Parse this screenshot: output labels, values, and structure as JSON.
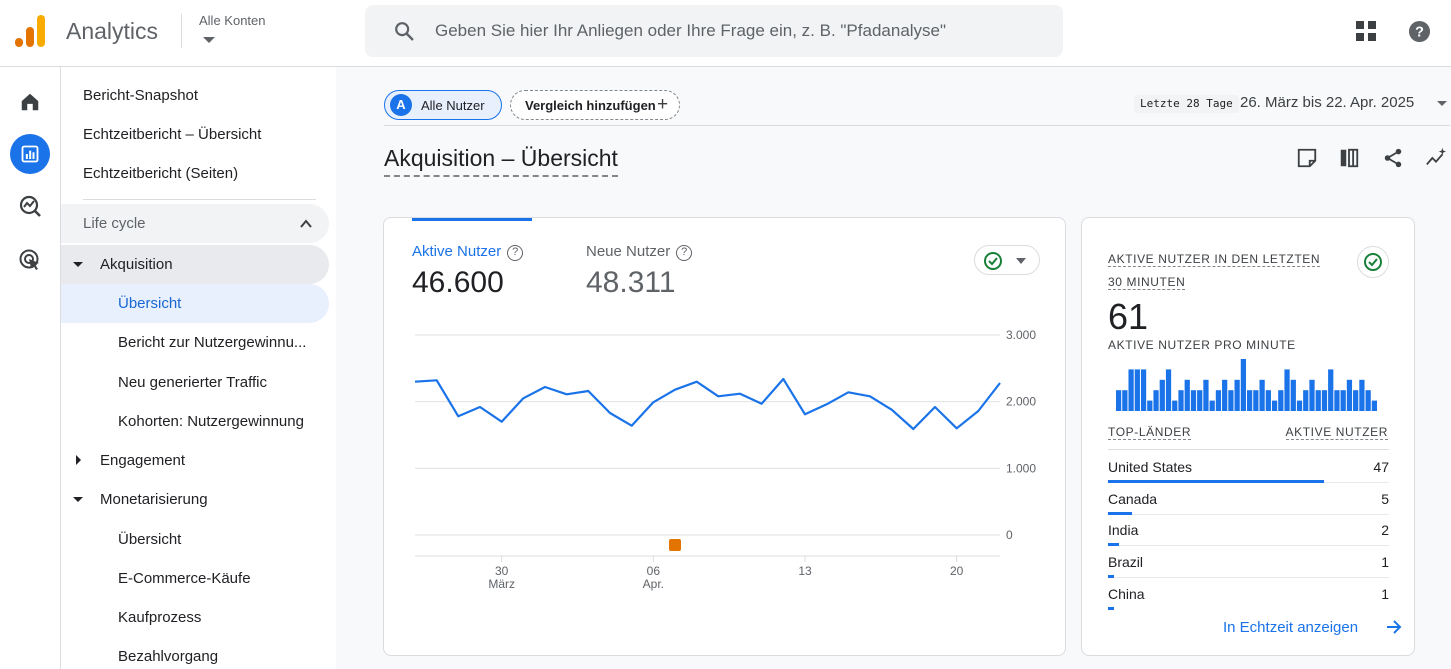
{
  "header": {
    "app_title": "Analytics",
    "account_label": "Alle Konten",
    "search_placeholder": "Geben Sie hier Ihr Anliegen oder Ihre Frage ein, z. B. \"Pfadanalyse\"",
    "logo_colors": [
      "#f9ab00",
      "#e37400"
    ]
  },
  "rail": {
    "items": [
      {
        "icon": "home-icon",
        "active": false
      },
      {
        "icon": "reports-icon",
        "active": true
      },
      {
        "icon": "explore-icon",
        "active": false
      },
      {
        "icon": "advertising-icon",
        "active": false
      }
    ]
  },
  "nav": {
    "top_items": [
      "Bericht-Snapshot",
      "Echtzeitbericht – Übersicht",
      "Echtzeitbericht (Seiten)"
    ],
    "lifecycle_label": "Life cycle",
    "sections": [
      {
        "label": "Akquisition",
        "open": true,
        "children": [
          {
            "label": "Übersicht",
            "selected": true
          },
          {
            "label": "Bericht zur Nutzergewinnu..."
          },
          {
            "label": "Neu generierter Traffic"
          },
          {
            "label": "Kohorten: Nutzergewinnung"
          }
        ]
      },
      {
        "label": "Engagement",
        "open": false,
        "children": []
      },
      {
        "label": "Monetarisierung",
        "open": true,
        "children": [
          {
            "label": "Übersicht"
          },
          {
            "label": "E-Commerce-Käufe"
          },
          {
            "label": "Kaufprozess"
          },
          {
            "label": "Bezahlvorgang"
          }
        ]
      }
    ]
  },
  "filters": {
    "segment_badge": "A",
    "segment_label": "Alle Nutzer",
    "compare_label": "Vergleich hinzufügen",
    "date_badge": "Letzte 28 Tage",
    "date_range": "26. März bis 22. Apr. 2025"
  },
  "page": {
    "title": "Akquisition – Übersicht",
    "tool_icons": [
      "customize-report-icon",
      "compare-columns-icon",
      "share-icon",
      "insights-icon"
    ]
  },
  "metrics": {
    "active_label": "Aktive Nutzer",
    "active_value": "46.600",
    "new_label": "Neue Nutzer",
    "new_value": "48.311",
    "help_glyph": "?"
  },
  "chart_data": {
    "type": "line",
    "series": [
      {
        "values": [
          2300,
          2320,
          1780,
          1920,
          1700,
          2050,
          2220,
          2110,
          2160,
          1830,
          1640,
          1990,
          2180,
          2300,
          2080,
          2120,
          1970,
          2340,
          1810,
          1960,
          2140,
          2080,
          1880,
          1590,
          1920,
          1600,
          1860,
          2280
        ],
        "color": "#1a73e8"
      }
    ],
    "x_tick_labels": [
      {
        "day": "30",
        "month": "März",
        "index": 4
      },
      {
        "day": "06",
        "month": "Apr.",
        "index": 11
      },
      {
        "day": "13",
        "month": "",
        "index": 18
      },
      {
        "day": "20",
        "month": "",
        "index": 25
      }
    ],
    "y_tick_labels": [
      "3.000",
      "2.000",
      "1.000",
      "0"
    ],
    "ylim": [
      0,
      3000
    ],
    "annotation_marker_index": 12,
    "annotation_color": "#e37400",
    "grid": true
  },
  "realtime": {
    "heading_line1": "AKTIVE NUTZER IN DEN LETZTEN",
    "heading_line2": "30 MINUTEN",
    "count": "61",
    "per_minute_label": "AKTIVE NUTZER PRO MINUTE",
    "per_minute_bars": [
      2,
      2,
      4,
      4,
      4,
      1,
      2,
      3,
      4,
      1,
      2,
      3,
      2,
      2,
      3,
      1,
      2,
      3,
      2,
      3,
      5,
      2,
      2,
      3,
      2,
      1,
      2,
      4,
      3,
      1,
      2,
      3,
      2,
      2,
      4,
      2,
      2,
      3,
      2,
      3,
      2,
      1
    ],
    "col_country": "TOP-LÄNDER",
    "col_users": "AKTIVE NUTZER",
    "rows": [
      {
        "country": "United States",
        "value": "47",
        "share": 1.0
      },
      {
        "country": "Canada",
        "value": "5",
        "share": 0.11
      },
      {
        "country": "India",
        "value": "2",
        "share": 0.05
      },
      {
        "country": "Brazil",
        "value": "1",
        "share": 0.03
      },
      {
        "country": "China",
        "value": "1",
        "share": 0.03
      }
    ],
    "link_label": "In Echtzeit anzeigen"
  }
}
